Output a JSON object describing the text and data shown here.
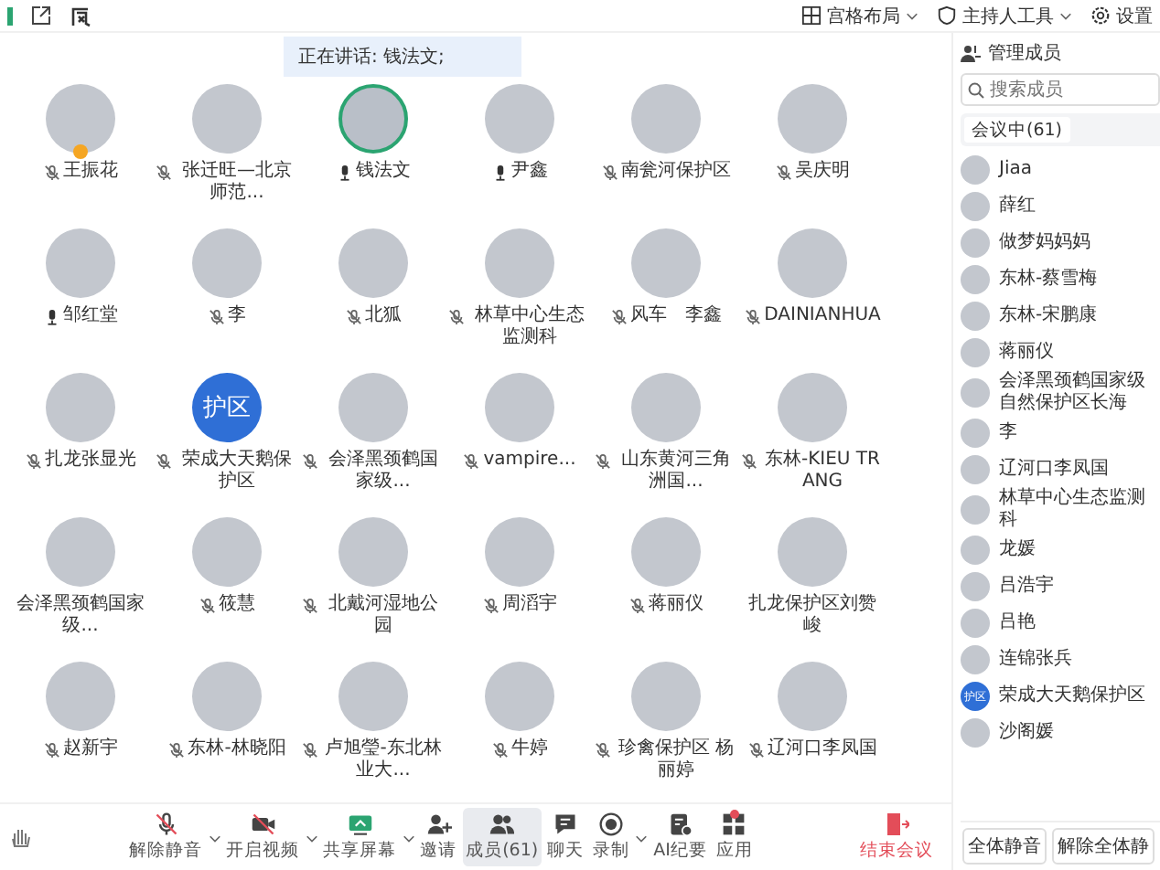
{
  "top_bar": {
    "right_items": [
      {
        "label": "宫格布局",
        "dropdown": true
      },
      {
        "label": "主持人工具",
        "dropdown": true
      },
      {
        "label": "设置",
        "dropdown": false
      }
    ]
  },
  "speaking_banner": "正在讲话: 钱法文;",
  "tiles": [
    {
      "name": "王振花",
      "muted": true,
      "speaking": false,
      "host": true
    },
    {
      "name": "张迁旺—北京师范...",
      "muted": true,
      "speaking": false
    },
    {
      "name": "钱法文",
      "muted": false,
      "speaking": true
    },
    {
      "name": "尹鑫",
      "muted": false,
      "speaking": false
    },
    {
      "name": "南瓮河保护区",
      "muted": true,
      "speaking": false
    },
    {
      "name": "吴庆明",
      "muted": true,
      "speaking": false
    },
    {
      "name": "邹红堂",
      "muted": false,
      "speaking": false
    },
    {
      "name": "李",
      "muted": true,
      "speaking": false
    },
    {
      "name": "北狐",
      "muted": true,
      "speaking": false
    },
    {
      "name": "林草中心生态监测科",
      "muted": true,
      "speaking": false
    },
    {
      "name": "风车　李鑫",
      "muted": true,
      "speaking": false
    },
    {
      "name": "DAINIANHUA",
      "muted": true,
      "speaking": false
    },
    {
      "name": "扎龙张显光",
      "muted": true,
      "speaking": false
    },
    {
      "name": "荣成大天鹅保护区",
      "muted": true,
      "speaking": false,
      "avatar_text": "护区"
    },
    {
      "name": "会泽黑颈鹤国家级...",
      "muted": true,
      "speaking": false
    },
    {
      "name": "vampire...",
      "muted": true,
      "speaking": false
    },
    {
      "name": "山东黄河三角洲国...",
      "muted": true,
      "speaking": false
    },
    {
      "name": "东林-KIEU TRANG",
      "muted": true,
      "speaking": false
    },
    {
      "name": "会泽黑颈鹤国家级...",
      "speaking": false
    },
    {
      "name": "筱慧",
      "muted": true,
      "speaking": false
    },
    {
      "name": "北戴河湿地公园",
      "muted": true,
      "speaking": false
    },
    {
      "name": "周滔宇",
      "muted": true,
      "speaking": false
    },
    {
      "name": "蒋丽仪",
      "muted": true,
      "speaking": false
    },
    {
      "name": "扎龙保护区刘赞峻",
      "speaking": false
    },
    {
      "name": "赵新宇",
      "muted": true,
      "speaking": false
    },
    {
      "name": "东林-林晓阳",
      "muted": true,
      "speaking": false
    },
    {
      "name": "卢旭瑩-东北林业大...",
      "muted": true,
      "speaking": false
    },
    {
      "name": "牛婷",
      "muted": true,
      "speaking": false
    },
    {
      "name": "珍禽保护区 杨丽婷",
      "muted": true,
      "speaking": false
    },
    {
      "name": "辽河口李凤国",
      "muted": true,
      "speaking": false
    }
  ],
  "toolbar": [
    {
      "label": "解除静音",
      "dropdown": true,
      "selected": false,
      "badge": false
    },
    {
      "label": "开启视频",
      "dropdown": true,
      "selected": false,
      "badge": false
    },
    {
      "label": "共享屏幕",
      "dropdown": true,
      "selected": false,
      "badge": false
    },
    {
      "label": "邀请",
      "dropdown": false,
      "selected": false,
      "badge": false
    },
    {
      "label": "成员(61)",
      "dropdown": false,
      "selected": true,
      "badge": false
    },
    {
      "label": "聊天",
      "dropdown": false,
      "selected": false,
      "badge": false
    },
    {
      "label": "录制",
      "dropdown": true,
      "selected": false,
      "badge": false
    },
    {
      "label": "AI纪要",
      "dropdown": false,
      "selected": false,
      "badge": false
    },
    {
      "label": "应用",
      "dropdown": false,
      "selected": false,
      "badge": true
    }
  ],
  "end_button": "结束会议",
  "members_panel": {
    "title": "管理成员",
    "search": {
      "placeholder": "搜索成员"
    },
    "tabs": [
      {
        "label": "会议中(61)",
        "selected": true
      }
    ],
    "members": [
      {
        "name": "Jiaa"
      },
      {
        "name": "薛红"
      },
      {
        "name": "做梦妈妈妈"
      },
      {
        "name": "东林-蔡雪梅"
      },
      {
        "name": "东林-宋鹏康"
      },
      {
        "name": "蒋丽仪"
      },
      {
        "name": "会泽黑颈鹤国家级自然保护区长海"
      },
      {
        "name": "李"
      },
      {
        "name": "辽河口李凤国"
      },
      {
        "name": "林草中心生态监测科"
      },
      {
        "name": "龙媛"
      },
      {
        "name": "吕浩宇"
      },
      {
        "name": "吕艳"
      },
      {
        "name": "连锦张兵"
      },
      {
        "name": "荣成大天鹅保护区",
        "avatar_text": "护区"
      },
      {
        "name": "沙阁媛"
      }
    ],
    "buttons": [
      "全体静音",
      "解除全体静"
    ]
  }
}
